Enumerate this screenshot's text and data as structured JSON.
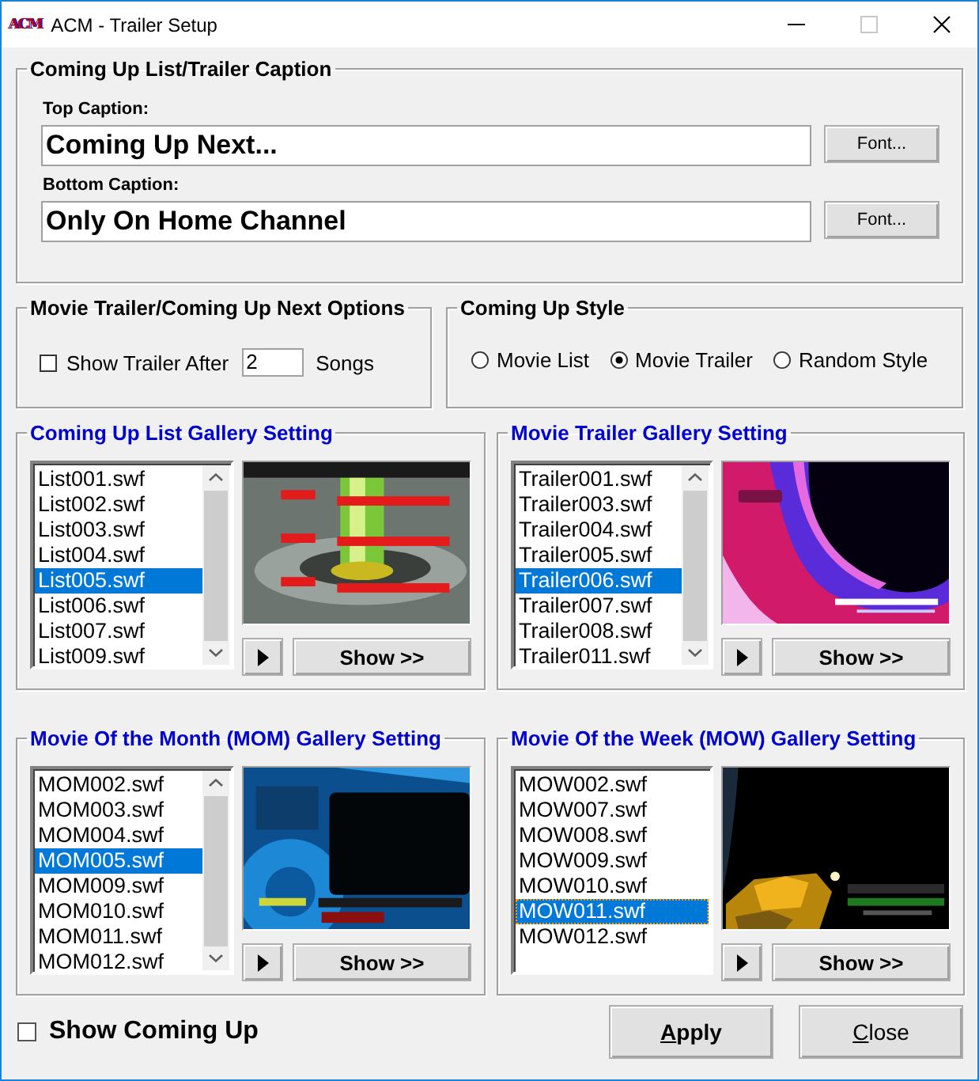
{
  "window": {
    "icon_text": "ACM",
    "title": "ACM - Trailer Setup"
  },
  "caption_group": {
    "title": "Coming Up List/Trailer Caption",
    "fields": [
      {
        "label": "Top Caption:",
        "value": "Coming Up Next...",
        "button": "Font..."
      },
      {
        "label": "Bottom Caption:",
        "value": "Only On Home Channel",
        "button": "Font..."
      }
    ]
  },
  "options_group": {
    "title": "Movie Trailer/Coming Up Next Options",
    "checkbox": {
      "label": "Show Trailer After",
      "checked": false
    },
    "count": "2",
    "unit": "Songs"
  },
  "style_group": {
    "title": "Coming Up Style",
    "options": [
      {
        "label": "Movie List",
        "selected": false
      },
      {
        "label": "Movie Trailer",
        "selected": true
      },
      {
        "label": "Random Style",
        "selected": false
      }
    ]
  },
  "galleries": [
    {
      "title": "Coming Up List Gallery Setting",
      "has_scrollbar": true,
      "show_button": "Show >>",
      "preview": {
        "kind": "picture"
      },
      "items": [
        {
          "label": "List001.swf",
          "selected": false,
          "focused": false
        },
        {
          "label": "List002.swf",
          "selected": false,
          "focused": false
        },
        {
          "label": "List003.swf",
          "selected": false,
          "focused": false
        },
        {
          "label": "List004.swf",
          "selected": false,
          "focused": false
        },
        {
          "label": "List005.swf",
          "selected": true,
          "focused": false
        },
        {
          "label": "List006.swf",
          "selected": false,
          "focused": false
        },
        {
          "label": "List007.swf",
          "selected": false,
          "focused": false
        },
        {
          "label": "List009.swf",
          "selected": false,
          "focused": false
        }
      ]
    },
    {
      "title": "Movie Trailer Gallery Setting",
      "has_scrollbar": true,
      "show_button": "Show >>",
      "preview": {
        "kind": "picture"
      },
      "items": [
        {
          "label": "Trailer001.swf",
          "selected": false,
          "focused": false
        },
        {
          "label": "Trailer003.swf",
          "selected": false,
          "focused": false
        },
        {
          "label": "Trailer004.swf",
          "selected": false,
          "focused": false
        },
        {
          "label": "Trailer005.swf",
          "selected": false,
          "focused": false
        },
        {
          "label": "Trailer006.swf",
          "selected": true,
          "focused": false
        },
        {
          "label": "Trailer007.swf",
          "selected": false,
          "focused": false
        },
        {
          "label": "Trailer008.swf",
          "selected": false,
          "focused": false
        },
        {
          "label": "Trailer011.swf",
          "selected": false,
          "focused": false
        }
      ]
    },
    {
      "title": "Movie Of the Month (MOM) Gallery Setting",
      "has_scrollbar": true,
      "show_button": "Show >>",
      "preview": {
        "kind": "picture"
      },
      "items": [
        {
          "label": "MOM002.swf",
          "selected": false,
          "focused": false
        },
        {
          "label": "MOM003.swf",
          "selected": false,
          "focused": false
        },
        {
          "label": "MOM004.swf",
          "selected": false,
          "focused": false
        },
        {
          "label": "MOM005.swf",
          "selected": true,
          "focused": false
        },
        {
          "label": "MOM009.swf",
          "selected": false,
          "focused": false
        },
        {
          "label": "MOM010.swf",
          "selected": false,
          "focused": false
        },
        {
          "label": "MOM011.swf",
          "selected": false,
          "focused": false
        },
        {
          "label": "MOM012.swf",
          "selected": false,
          "focused": false
        }
      ]
    },
    {
      "title": "Movie Of the Week (MOW) Gallery Setting",
      "has_scrollbar": false,
      "show_button": "Show >>",
      "preview": {
        "kind": "picture"
      },
      "items": [
        {
          "label": "MOW002.swf",
          "selected": false,
          "focused": false
        },
        {
          "label": "MOW007.swf",
          "selected": false,
          "focused": false
        },
        {
          "label": "MOW008.swf",
          "selected": false,
          "focused": false
        },
        {
          "label": "MOW009.swf",
          "selected": false,
          "focused": false
        },
        {
          "label": "MOW010.swf",
          "selected": false,
          "focused": false
        },
        {
          "label": "MOW011.swf",
          "selected": true,
          "focused": true
        },
        {
          "label": "MOW012.swf",
          "selected": false,
          "focused": false
        }
      ]
    }
  ],
  "show_coming_up": {
    "label": "Show Coming Up",
    "checked": false
  },
  "buttons": [
    {
      "label": "Apply",
      "kind": "default"
    },
    {
      "label": "Close",
      "kind": "normal"
    }
  ]
}
